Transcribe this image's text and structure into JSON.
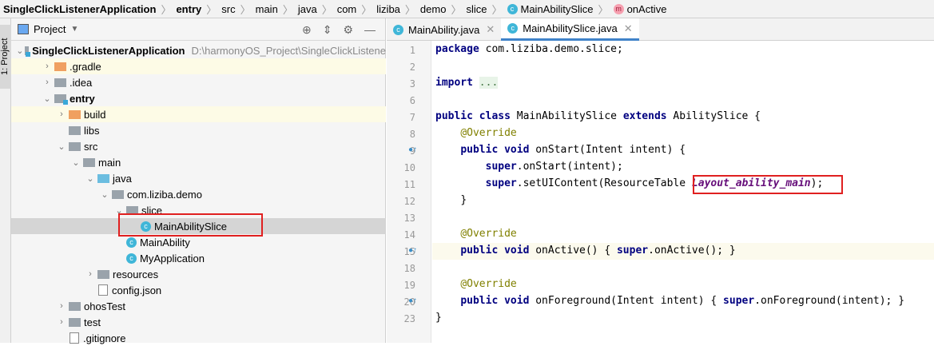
{
  "breadcrumb": [
    "SingleClickListenerApplication",
    "entry",
    "src",
    "main",
    "java",
    "com",
    "liziba",
    "demo",
    "slice",
    "MainAbilitySlice",
    "onActive"
  ],
  "strip_label": "1: Project",
  "panel": {
    "title": "Project"
  },
  "tree": [
    {
      "label": "SingleClickListenerApplication",
      "path": "D:\\harmonyOS_Project\\SingleClickListene"
    },
    {
      "label": ".gradle"
    },
    {
      "label": ".idea"
    },
    {
      "label": "entry"
    },
    {
      "label": "build"
    },
    {
      "label": "libs"
    },
    {
      "label": "src"
    },
    {
      "label": "main"
    },
    {
      "label": "java"
    },
    {
      "label": "com.liziba.demo"
    },
    {
      "label": "slice"
    },
    {
      "label": "MainAbilitySlice"
    },
    {
      "label": "MainAbility"
    },
    {
      "label": "MyApplication"
    },
    {
      "label": "resources"
    },
    {
      "label": "config.json"
    },
    {
      "label": "ohosTest"
    },
    {
      "label": "test"
    },
    {
      "label": ".gitignore"
    }
  ],
  "tabs": [
    {
      "label": "MainAbility.java"
    },
    {
      "label": "MainAbilitySlice.java"
    }
  ],
  "lines": [
    "1",
    "2",
    "3",
    "6",
    "7",
    "8",
    "9",
    "10",
    "11",
    "12",
    "13",
    "14",
    "15",
    "18",
    "19",
    "20",
    "23"
  ],
  "code": {
    "l1a": "package",
    "l1b": " com.liziba.demo.slice;",
    "l3a": "import",
    "l3b": "...",
    "l7a": "public class",
    "l7b": " MainAbilitySlice ",
    "l7c": "extends",
    "l7d": " AbilitySlice {",
    "ov": "@Override",
    "pv": "public void",
    "l9": " onStart(Intent intent) {",
    "sup": "super",
    "l10": ".onStart(intent);",
    "l11": ".setUIContent(ResourceTable",
    "l11i": "Layout_ability_main",
    "l11e": ");",
    "close": "}",
    "l15": " onActive() { ",
    "l15b": ".onActive(); }",
    "l20": " onForeground(Intent intent) { ",
    "l20b": ".onForeground(intent); }"
  }
}
